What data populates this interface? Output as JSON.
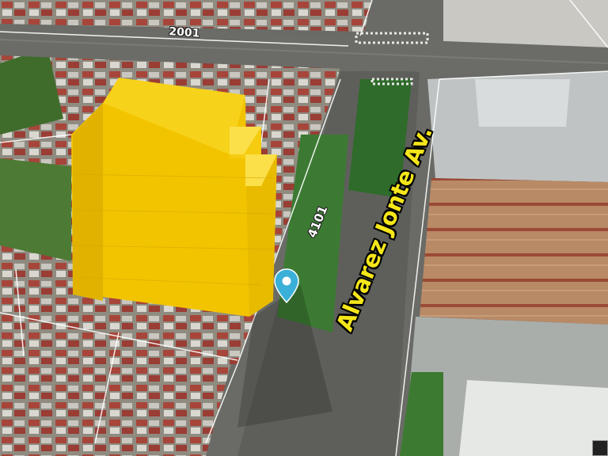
{
  "map": {
    "view": "3D satellite",
    "street_name": "Alvarez Jonte Av.",
    "street_number_side": "4101",
    "street_number_top": "2001"
  },
  "building": {
    "color": "#f2c400"
  },
  "marker": {
    "icon": "location-pin-icon",
    "color": "#3ab0d8"
  },
  "colors": {
    "road": "#5e5f5b",
    "roof_red": "#a7453a",
    "roof_rust": "#b46a45",
    "warehouse_gray": "#b9bdbd",
    "vegetation": "#2f6b2a",
    "parcel_line": "#ffffff"
  }
}
